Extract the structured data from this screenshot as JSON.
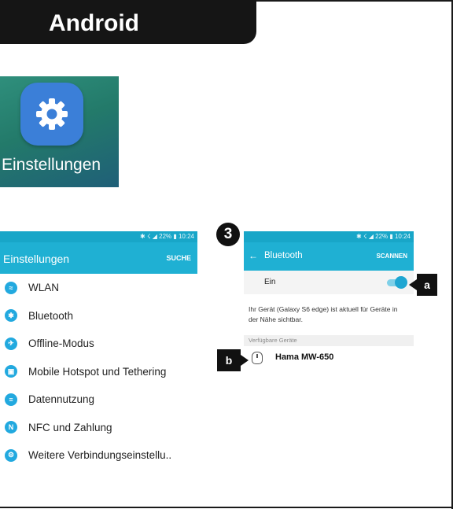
{
  "header": {
    "os_label": "Android"
  },
  "app_icon": {
    "label": "Einstellungen",
    "icon": "gear-icon"
  },
  "settings_screen": {
    "statusbar": "✱ ☇ ◢ 22% ▮ 10:24",
    "title": "Einstellungen",
    "action": "SUCHE",
    "items": [
      {
        "label": "WLAN",
        "icon": "wifi-icon"
      },
      {
        "label": "Bluetooth",
        "icon": "bluetooth-icon"
      },
      {
        "label": "Offline-Modus",
        "icon": "airplane-icon"
      },
      {
        "label": "Mobile Hotspot und Tethering",
        "icon": "hotspot-icon"
      },
      {
        "label": "Datennutzung",
        "icon": "data-usage-icon"
      },
      {
        "label": "NFC und Zahlung",
        "icon": "nfc-icon"
      },
      {
        "label": "Weitere Verbindungseinstellu..",
        "icon": "more-connections-icon"
      }
    ]
  },
  "bluetooth_screen": {
    "statusbar": "✱ ☇ ◢ 22% ▮ 10:24",
    "title": "Bluetooth",
    "action": "SCANNEN",
    "toggle_label": "Ein",
    "toggle_on": true,
    "info": "Ihr Gerät (Galaxy S6 edge) ist aktuell für Geräte in der Nähe sichtbar.",
    "section_header": "Verfügbare Geräte",
    "device_name": "Hama MW-650"
  },
  "callouts": {
    "step": "3",
    "a": "a",
    "b": "b"
  },
  "colors": {
    "accent": "#1fb0d3",
    "statusbar": "#18a6c8",
    "icon_blue": "#22a9df",
    "badge": "#111111"
  }
}
